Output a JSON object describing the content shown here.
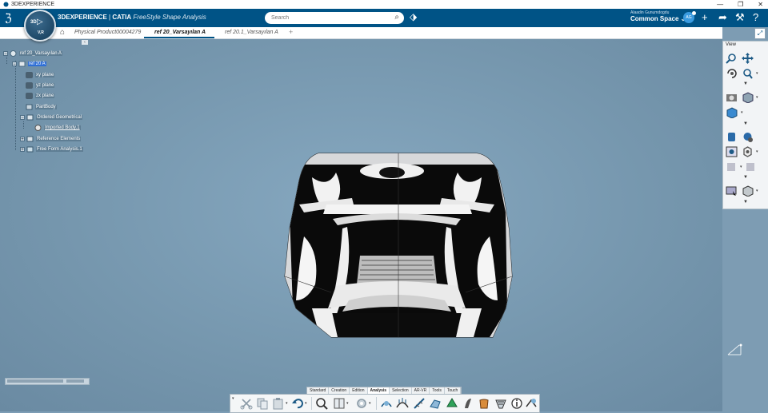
{
  "window": {
    "title": "3DEXPERIENCE",
    "controls": [
      "—",
      "❐",
      "✕"
    ]
  },
  "topbar": {
    "brand_main": "3DEXPERIENCE",
    "brand_sep": " | ",
    "brand_catia": "CATIA",
    "brand_app": " FreeStyle Shape Analysis",
    "compass_3d": "3D",
    "compass_ver": "V,R",
    "search_placeholder": "Search",
    "user_name": "Alaadin Gunumdogdu",
    "space": "Common Space ⌄",
    "avatar_initials": "AG",
    "accent": "#005386"
  },
  "tabs": [
    {
      "label": "Physical Product00004279",
      "active": false
    },
    {
      "label": "ref 20_Varsayılan A",
      "active": true
    },
    {
      "label": "ref 20.1_Varsayılan A",
      "active": false
    }
  ],
  "tree": {
    "root": "ref 20_Varsayılan A",
    "part": "ref 20 A",
    "xy": "xy plane",
    "yz": "yz plane",
    "zx": "zx plane",
    "partbody": "PartBody",
    "ogs": "Ordered Geometrical",
    "imported": "Imported Body.1",
    "refel": "Reference Elements",
    "ffa": "Free Form Analysis.1"
  },
  "view_panel": {
    "title": "View"
  },
  "action_tabs": [
    "Standard",
    "Creation",
    "Edition",
    "Analysis",
    "Selection",
    "AR-VR",
    "Tools",
    "Touch"
  ],
  "active_action_tab": "Analysis",
  "action_icons": [
    "cut-icon",
    "copy-icon",
    "paste-icon",
    "undo-icon",
    "measure-icon",
    "catalog-icon",
    "settings-icon",
    "connect-checker-icon",
    "curvature-icon",
    "porcupine-icon",
    "surfacic-curvature-icon",
    "draft-analysis-icon",
    "highlight-icon",
    "reflect-lines-icon",
    "isophotes-icon",
    "cutting-plane-icon",
    "info-icon",
    "apply-dress-up-icon"
  ]
}
